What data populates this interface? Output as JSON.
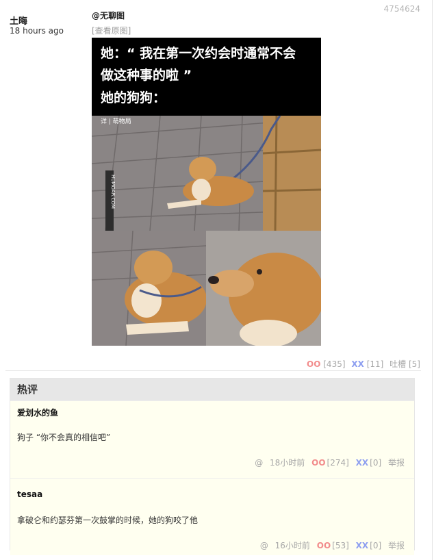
{
  "post": {
    "id": "4754624",
    "author": "土晦",
    "time": "18 hours ago",
    "tag": "@无聊图",
    "view_original": "[查看原图]",
    "meme": {
      "caption_lines": [
        "她：“ 我在第一次约会时通常不会",
        "做这种事的啦 ”",
        "她的狗狗："
      ],
      "source_label": "详 | 萌物局",
      "watermark": "HUMOAR.COM"
    },
    "votes": {
      "oo": "OO",
      "oo_count": "[435]",
      "xx": "XX",
      "xx_count": "[11]",
      "tucao": "吐槽 [5]"
    }
  },
  "hot_comments": {
    "title": "热评",
    "items": [
      {
        "author": "爱划水的鱼",
        "text": "狗子 “你不会真的相信吧”",
        "at": "@",
        "time": "18小时前",
        "oo": "OO",
        "oo_count": "[274]",
        "xx": "XX",
        "xx_count": "[0]",
        "report": "举报"
      },
      {
        "author": "tesaa",
        "text": "拿破仑和约瑟芬第一次鼓掌的时候，她的狗咬了他",
        "at": "@",
        "time": "16小时前",
        "oo": "OO",
        "oo_count": "[53]",
        "xx": "XX",
        "xx_count": "[0]",
        "report": "举报"
      }
    ]
  },
  "colors": {
    "oo": "#f28c8c",
    "xx": "#8e9ff0",
    "comment_bg": "#fffff0",
    "header_bg": "#e7e7e7"
  }
}
